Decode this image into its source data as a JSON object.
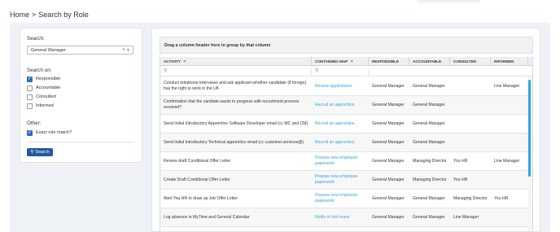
{
  "breadcrumb": {
    "home": "Home",
    "separator": ">",
    "current": "Search by Role"
  },
  "search_panel": {
    "search_label": "Search:",
    "role_value": "General Manager",
    "clear_glyph": "×",
    "search_on_label": "Search on:",
    "options": [
      {
        "label": "Responsible",
        "checked": true
      },
      {
        "label": "Accountable",
        "checked": false
      },
      {
        "label": "Consulted",
        "checked": false
      },
      {
        "label": "Informed",
        "checked": false
      }
    ],
    "other_label": "Other:",
    "exact_role_match": {
      "label": "Exact role match?",
      "checked": true
    },
    "search_button": "Search"
  },
  "grid": {
    "group_hint": "Drag a column header here to group by that column",
    "columns": [
      "ACTIVITY",
      "CONTAINING MAP",
      "RESPONSIBLE",
      "ACCOUNTABLE",
      "CONSULTED",
      "INFORMED"
    ],
    "rows": [
      {
        "activity": "Conduct telephone interviews and ask applicant whether candidate (if foreign) has the right to work in the UK",
        "map": "Review applications",
        "responsible": "General Manager",
        "accountable": "General Manager",
        "consulted": "",
        "informed": "Line Manager"
      },
      {
        "activity": "Confirmation that the candiate wants to progress with recruitment process received?",
        "map": "Recruit an apprentice",
        "responsible": "General Manager",
        "accountable": "General Manager",
        "consulted": "",
        "informed": ""
      },
      {
        "activity": "Send Initial Introductory Apprentice Software Developer email (cc MC and CM)",
        "map": "Recruit an apprentice",
        "responsible": "General Manager",
        "accountable": "General Manager",
        "consulted": "",
        "informed": ""
      },
      {
        "activity": "Send Initial Introductory Technical apprentice email (cc customer.services@)",
        "map": "Recruit an apprentice",
        "responsible": "General Manager",
        "accountable": "General Manager",
        "consulted": "",
        "informed": ""
      },
      {
        "activity": "Review draft Conditional Offer Letter",
        "map": "Prepare new employee paperwork",
        "responsible": "General Manager",
        "accountable": "Managing Director",
        "consulted": "You HR",
        "informed": "Line Manager"
      },
      {
        "activity": "Create Draft Conditional Offer Letter",
        "map": "Prepare new employee paperwork",
        "responsible": "General Manager",
        "accountable": "Managing Director",
        "consulted": "You HR",
        "informed": ""
      },
      {
        "activity": "Alert You HR to draw up Job Offer Letter",
        "map": "Prepare new employee paperwork",
        "responsible": "General Manager",
        "accountable": "General Manager",
        "consulted": "Managing Director",
        "informed": "You HR"
      },
      {
        "activity": "Log absence in MyTime and General Calendar",
        "map": "Notify of sick leave",
        "responsible": "General Manager",
        "accountable": "General Manager",
        "consulted": "Line Manager",
        "informed": ""
      }
    ]
  },
  "colors": {
    "accent": "#1f5aa0",
    "checkbox": "#2f6fb5",
    "link": "#3aa0d8",
    "scrollbar": "#2aa7e3"
  },
  "icons": {
    "search": "magnifier-icon",
    "filter": "filter-funnel-icon",
    "clear": "close-icon",
    "dropdown": "chevron-down-icon"
  }
}
